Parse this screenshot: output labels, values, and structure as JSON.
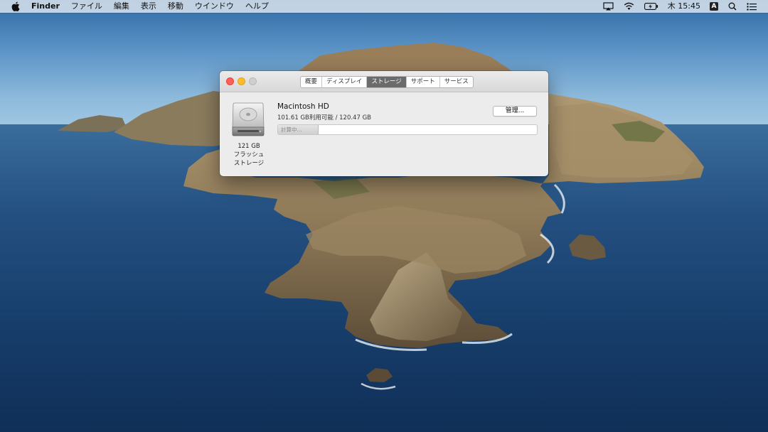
{
  "menubar": {
    "app_name": "Finder",
    "menus": [
      "ファイル",
      "編集",
      "表示",
      "移動",
      "ウインドウ",
      "ヘルプ"
    ],
    "clock": "木 15:45",
    "input_source": "A",
    "icons": [
      "apple-icon",
      "airplay-icon",
      "wifi-icon",
      "battery-icon",
      "input-source-icon",
      "spotlight-icon",
      "notification-center-icon"
    ]
  },
  "window": {
    "tabs": [
      {
        "label": "概要",
        "active": false
      },
      {
        "label": "ディスプレイ",
        "active": false
      },
      {
        "label": "ストレージ",
        "active": true
      },
      {
        "label": "サポート",
        "active": false
      },
      {
        "label": "サービス",
        "active": false
      }
    ],
    "drive": {
      "icon": "hard-drive-icon",
      "capacity": "121 GB",
      "type_line1": "フラッシュ",
      "type_line2": "ストレージ"
    },
    "disk": {
      "name": "Macintosh HD",
      "usage": "101.61 GB利用可能 / 120.47 GB",
      "bar_status": "計算中...",
      "bar_fraction": 0.155
    },
    "manage_button": "管理..."
  },
  "colors": {
    "close": "#fe5f57",
    "minimize": "#febc2e",
    "zoom_disabled": "#cfcfcf",
    "active_tab": "#6b6b6b"
  }
}
